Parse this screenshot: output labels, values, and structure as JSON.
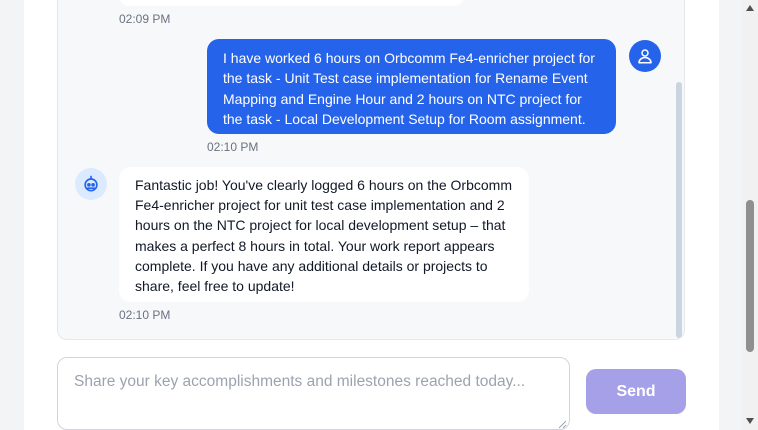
{
  "chat": {
    "messages": [
      {
        "role": "assistant",
        "time": "02:09 PM"
      },
      {
        "role": "user",
        "text": "I have worked 6 hours on Orbcomm Fe4-enricher project for the task - Unit Test case implementation for Rename Event Mapping and Engine Hour and 2 hours on NTC project for the task - Local Development Setup for Room assignment.",
        "lines": [
          "I have worked 6 hours on Orbcomm Fe4-enricher project for",
          "the task - Unit Test case implementation for Rename Event",
          "Mapping and Engine Hour and 2 hours on NTC project for",
          "the task - Local Development Setup for Room assignment."
        ],
        "time": "02:10 PM",
        "avatar_icon": "user-icon"
      },
      {
        "role": "assistant",
        "text": "Fantastic job! You've clearly logged 6 hours on the Orbcomm Fe4-enricher project for unit test case implementation and 2 hours on the NTC project for local development setup – that makes a perfect 8 hours in total. Your work report appears complete. If you have any additional details or projects to share, feel free to update!",
        "lines": [
          "Fantastic job! You've clearly logged 6 hours on the Orbcomm",
          "Fe4-enricher project for unit test case implementation and 2",
          "hours on the NTC project for local development setup – that",
          "makes a perfect 8 hours in total. Your work report appears",
          "complete. If you have any additional details or projects to",
          "share, feel free to update!"
        ],
        "time": "02:10 PM",
        "avatar_icon": "robot-icon"
      }
    ]
  },
  "composer": {
    "placeholder": "Share your key accomplishments and milestones reached today...",
    "value": ""
  },
  "send_button": {
    "label": "Send"
  },
  "colors": {
    "user_bubble": "#2563eb",
    "send_button": "#a5a0e8",
    "bot_avatar_bg": "#dbeafe",
    "chat_background": "#f7f8fa"
  }
}
